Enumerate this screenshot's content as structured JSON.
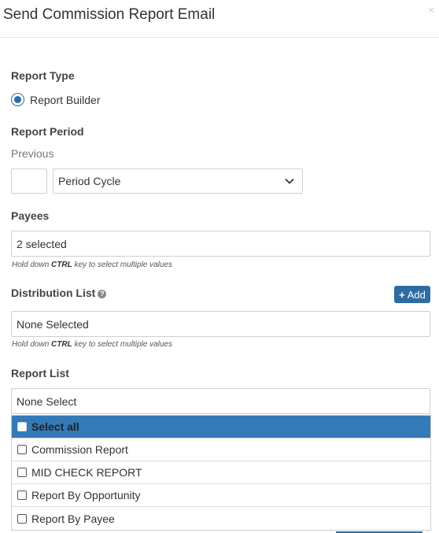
{
  "modal": {
    "title": "Send Commission Report Email",
    "close": "×"
  },
  "report_type": {
    "label": "Report Type",
    "option": "Report Builder",
    "selected": true
  },
  "report_period": {
    "label": "Report Period",
    "sub_label": "Previous",
    "number_value": "",
    "cycle_value": "Period Cycle"
  },
  "payees": {
    "label": "Payees",
    "value": "2 selected",
    "hint_before": "Hold down ",
    "hint_key": "CTRL",
    "hint_after": " key to select multiple values"
  },
  "distribution_list": {
    "label": "Distribution List",
    "help": "?",
    "add_label": "Add",
    "add_icon": "+",
    "value": "None Selected",
    "hint_before": "Hold down ",
    "hint_key": "CTRL",
    "hint_after": " key to select multiple values"
  },
  "report_list": {
    "label": "Report List",
    "value": "None Select",
    "options": [
      {
        "label": "Select all",
        "checked": false,
        "highlighted": true
      },
      {
        "label": "Commission Report",
        "checked": false,
        "highlighted": false
      },
      {
        "label": "MID CHECK REPORT",
        "checked": false,
        "highlighted": false
      },
      {
        "label": "Report By Opportunity",
        "checked": false,
        "highlighted": false
      },
      {
        "label": "Report By Payee",
        "checked": false,
        "highlighted": false
      }
    ]
  },
  "colors": {
    "accent": "#337ab7",
    "button": "#2e6da4"
  }
}
